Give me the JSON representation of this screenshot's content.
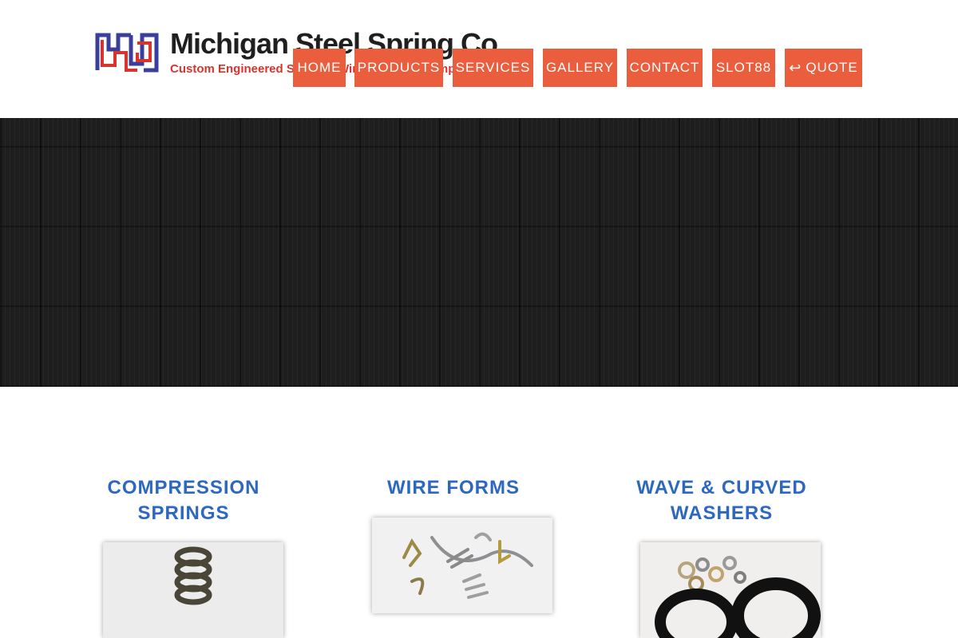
{
  "logo": {
    "title": "Michigan Steel Spring Co",
    "subtitle": "Custom Engineered Springs, Wire Forms & Stampings"
  },
  "nav": {
    "items": [
      {
        "label": "HOME"
      },
      {
        "label": "PRODUCTS"
      },
      {
        "label": "SERVICES"
      },
      {
        "label": "GALLERY"
      },
      {
        "label": "CONTACT"
      },
      {
        "label": "SLOT88"
      },
      {
        "label": "QUOTE",
        "icon": "reply-icon"
      }
    ]
  },
  "colors": {
    "nav_bg": "#ea5d3d",
    "product_title": "#2c68c0",
    "hero_bg": "#1e1e1e"
  },
  "products": [
    {
      "title_line1": "COMPRESSION",
      "title_line2": "SPRINGS"
    },
    {
      "title_line1": "WIRE FORMS",
      "title_line2": ""
    },
    {
      "title_line1": "WAVE & CURVED",
      "title_line2": "WASHERS"
    }
  ]
}
